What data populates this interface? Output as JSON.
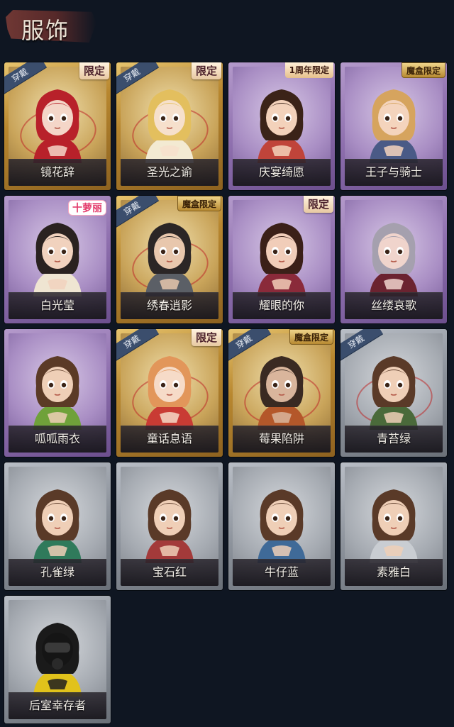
{
  "header": {
    "title": "服饰"
  },
  "costumes": [
    {
      "name": "镜花辞",
      "rarity": "gold",
      "wearing": true,
      "tag": "限定",
      "tag_type": "limit",
      "hair": "#b8212a",
      "skin": "#f4d6c8",
      "cloth": "#b8212a"
    },
    {
      "name": "圣光之谕",
      "rarity": "gold",
      "wearing": true,
      "tag": "限定",
      "tag_type": "limit",
      "hair": "#e3bf5e",
      "skin": "#f6e0cc",
      "cloth": "#f3ead2"
    },
    {
      "name": "庆宴绮愿",
      "rarity": "purple",
      "wearing": false,
      "tag": "1周年限定",
      "tag_type": "anniv",
      "hair": "#3b2318",
      "skin": "#f3d2bb",
      "cloth": "#c0443a"
    },
    {
      "name": "王子与骑士",
      "rarity": "purple",
      "wearing": false,
      "tag": "魔盒限定",
      "tag_type": "box",
      "hair": "#d6a45e",
      "skin": "#f4d4bd",
      "cloth": "#4a5a86"
    },
    {
      "name": "白光莹",
      "rarity": "purple",
      "wearing": false,
      "tag": "十萝丽",
      "tag_type": "lolita",
      "hair": "#2a2220",
      "skin": "#f1d2be",
      "cloth": "#efe5d2"
    },
    {
      "name": "绣春逍影",
      "rarity": "gold",
      "wearing": true,
      "tag": "魔盒限定",
      "tag_type": "box",
      "hair": "#2b2626",
      "skin": "#e8c7ad",
      "cloth": "#5b5f66"
    },
    {
      "name": "耀眼的你",
      "rarity": "purple",
      "wearing": false,
      "tag": "限定",
      "tag_type": "limit",
      "hair": "#3b2018",
      "skin": "#f1cdb9",
      "cloth": "#8a2a3a"
    },
    {
      "name": "丝缕哀歌",
      "rarity": "purple",
      "wearing": false,
      "tag": "",
      "tag_type": "none",
      "hair": "#a5a0ae",
      "skin": "#f0d4cc",
      "cloth": "#6b2330"
    },
    {
      "name": "呱呱雨衣",
      "rarity": "purple",
      "wearing": false,
      "tag": "",
      "tag_type": "none",
      "hair": "#5b3a26",
      "skin": "#efcfb7",
      "cloth": "#6fa13a"
    },
    {
      "name": "童话息语",
      "rarity": "gold",
      "wearing": true,
      "tag": "限定",
      "tag_type": "limit",
      "hair": "#e2965a",
      "skin": "#f6dbc8",
      "cloth": "#c93b34"
    },
    {
      "name": "莓果陷阱",
      "rarity": "gold",
      "wearing": true,
      "tag": "魔盒限定",
      "tag_type": "box",
      "hair": "#3a2a22",
      "skin": "#d9b59c",
      "cloth": "#b4572a"
    },
    {
      "name": "青苔绿",
      "rarity": "gray",
      "wearing": true,
      "tag": "",
      "tag_type": "none",
      "hair": "#5a3a28",
      "skin": "#efcfb7",
      "cloth": "#4a6a3a"
    },
    {
      "name": "孔雀绿",
      "rarity": "gray",
      "wearing": false,
      "tag": "",
      "tag_type": "none",
      "hair": "#5a3a28",
      "skin": "#efcfb7",
      "cloth": "#2f7a5b"
    },
    {
      "name": "宝石红",
      "rarity": "gray",
      "wearing": false,
      "tag": "",
      "tag_type": "none",
      "hair": "#5a3a28",
      "skin": "#efcfb7",
      "cloth": "#a33a3a"
    },
    {
      "name": "牛仔蓝",
      "rarity": "gray",
      "wearing": false,
      "tag": "",
      "tag_type": "none",
      "hair": "#5a3a28",
      "skin": "#efcfb7",
      "cloth": "#3f6a98"
    },
    {
      "name": "素雅白",
      "rarity": "gray",
      "wearing": false,
      "tag": "",
      "tag_type": "none",
      "hair": "#5a3a28",
      "skin": "#efcfb7",
      "cloth": "#c9cdd2"
    },
    {
      "name": "后室幸存者",
      "rarity": "gray",
      "wearing": false,
      "tag": "",
      "tag_type": "none",
      "hair": "#1a1a1a",
      "skin": "#1f1f1f",
      "cloth": "#e1c21b"
    }
  ],
  "labels": {
    "wearing": "穿戴"
  }
}
